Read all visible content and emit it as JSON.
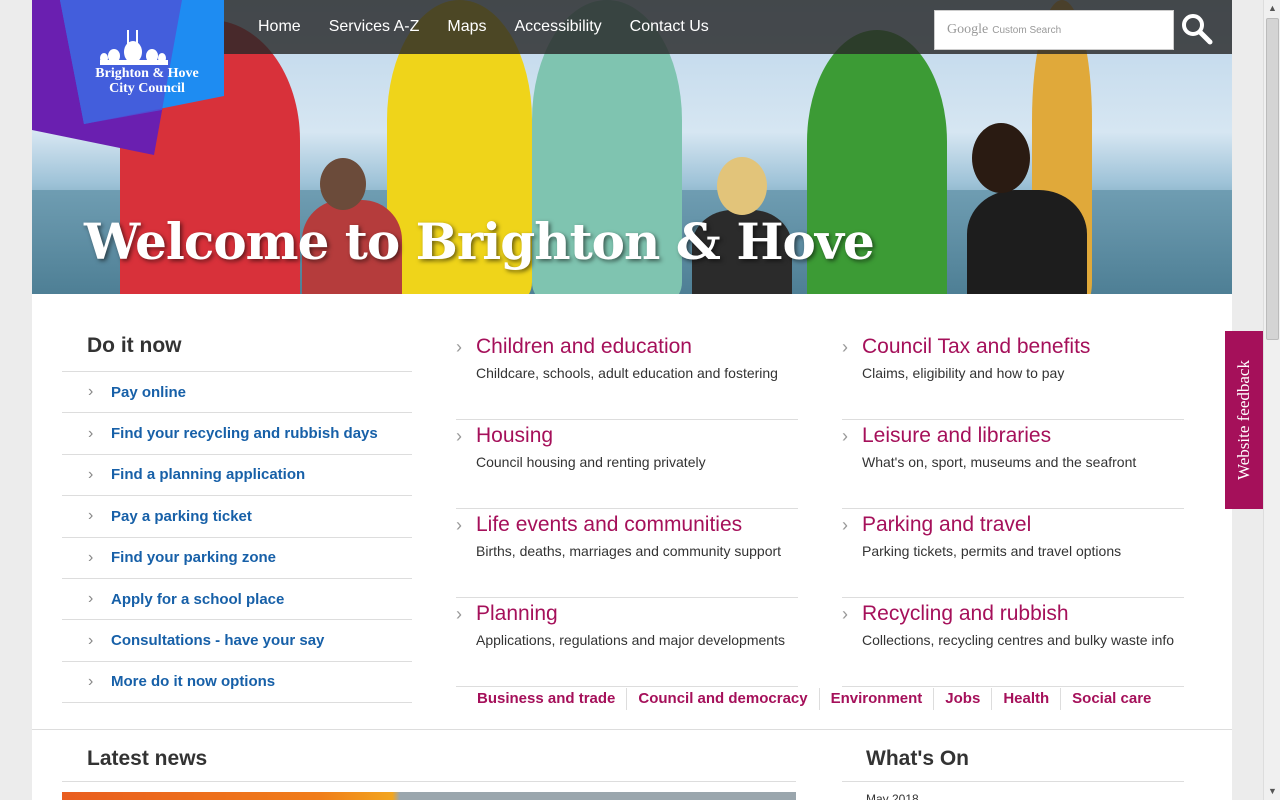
{
  "nav": {
    "items": [
      {
        "label": "Home"
      },
      {
        "label": "Services A-Z"
      },
      {
        "label": "Maps"
      },
      {
        "label": "Accessibility"
      },
      {
        "label": "Contact Us"
      }
    ]
  },
  "search": {
    "brand": "Google",
    "placeholder": "Custom Search",
    "icon": "search-icon"
  },
  "logo": {
    "line1": "Brighton & Hove",
    "line2": "City Council"
  },
  "hero": {
    "title": "Welcome to Brighton & Hove"
  },
  "do_it_now": {
    "title": "Do it now",
    "items": [
      {
        "label": "Pay online"
      },
      {
        "label": "Find your recycling and rubbish days"
      },
      {
        "label": "Find a planning application"
      },
      {
        "label": "Pay a parking ticket"
      },
      {
        "label": "Find your parking zone"
      },
      {
        "label": "Apply for a school place"
      },
      {
        "label": "Consultations - have your say"
      },
      {
        "label": "More do it now options"
      }
    ]
  },
  "categories": [
    {
      "title": "Children and education",
      "desc": "Childcare, schools, adult education and fostering"
    },
    {
      "title": "Council Tax and benefits",
      "desc": "Claims, eligibility and how to pay"
    },
    {
      "title": "Housing",
      "desc": "Council housing and renting privately"
    },
    {
      "title": "Leisure and libraries",
      "desc": "What's on, sport, museums and the seafront"
    },
    {
      "title": "Life events and communities",
      "desc": "Births, deaths, marriages and community support"
    },
    {
      "title": "Parking and travel",
      "desc": "Parking tickets, permits and travel options"
    },
    {
      "title": "Planning",
      "desc": "Applications, regulations and major developments"
    },
    {
      "title": "Recycling and rubbish",
      "desc": "Collections, recycling centres and bulky waste info"
    }
  ],
  "quick_links": [
    {
      "label": "Business and trade"
    },
    {
      "label": "Council and democracy"
    },
    {
      "label": "Environment"
    },
    {
      "label": "Jobs"
    },
    {
      "label": "Health"
    },
    {
      "label": "Social care"
    }
  ],
  "news": {
    "title": "Latest news"
  },
  "whats_on": {
    "title": "What's On",
    "date": "May 2018"
  },
  "feedback": {
    "label": "Website feedback"
  },
  "colors": {
    "accent": "#a5105a",
    "link": "#1760a8",
    "nav_bg": "#282828"
  }
}
